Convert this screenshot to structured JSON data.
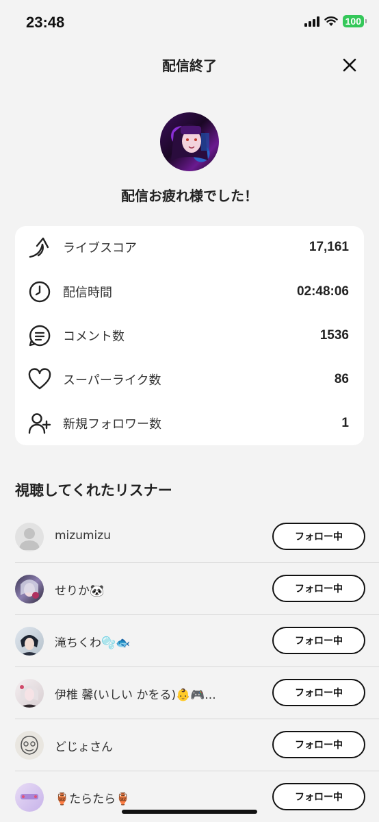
{
  "status_bar": {
    "time": "23:48",
    "battery": "100"
  },
  "header": {
    "title": "配信終了"
  },
  "summary": {
    "message": "配信お疲れ様でした！"
  },
  "stats": [
    {
      "icon": "arrow-up-curve-icon",
      "label": "ライブスコア",
      "value": "17,161"
    },
    {
      "icon": "clock-icon",
      "label": "配信時間",
      "value": "02:48:06"
    },
    {
      "icon": "comment-icon",
      "label": "コメント数",
      "value": "1536"
    },
    {
      "icon": "heart-icon",
      "label": "スーパーライク数",
      "value": "86"
    },
    {
      "icon": "add-user-icon",
      "label": "新規フォロワー数",
      "value": "1"
    }
  ],
  "listeners": {
    "title": "視聴してくれたリスナー",
    "items": [
      {
        "name": "mizumizu",
        "button": "フォロー中"
      },
      {
        "name": "せりか🐼",
        "button": "フォロー中"
      },
      {
        "name": "滝ちくわ🫧🐟",
        "button": "フォロー中"
      },
      {
        "name": "伊椎 馨(いしい かをる)👶🎮...",
        "button": "フォロー中"
      },
      {
        "name": "どじょさん",
        "button": "フォロー中"
      },
      {
        "name": "🏺たらたら🏺",
        "button": "フォロー中"
      }
    ]
  },
  "colors": {
    "background": "#f3f3f3",
    "card": "#ffffff",
    "battery": "#34c759",
    "text": "#222222"
  }
}
